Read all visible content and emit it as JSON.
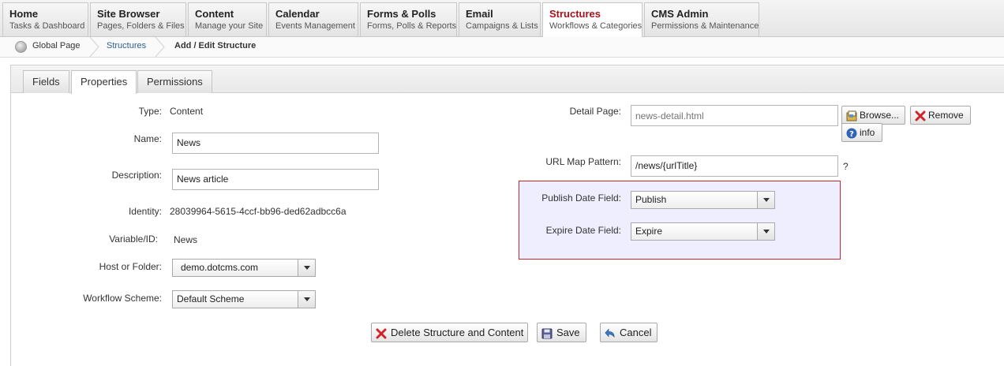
{
  "nav": {
    "tabs": [
      {
        "title": "Home",
        "subtitle": "Tasks & Dashboard"
      },
      {
        "title": "Site Browser",
        "subtitle": "Pages, Folders & Files"
      },
      {
        "title": "Content",
        "subtitle": "Manage your Site"
      },
      {
        "title": "Calendar",
        "subtitle": "Events Management"
      },
      {
        "title": "Forms & Polls",
        "subtitle": "Forms, Polls & Reports"
      },
      {
        "title": "Email",
        "subtitle": "Campaigns & Lists"
      },
      {
        "title": "Structures",
        "subtitle": "Workflows & Categories"
      },
      {
        "title": "CMS Admin",
        "subtitle": "Permissions & Maintenance"
      }
    ],
    "active": "Structures"
  },
  "breadcrumb": {
    "home": "Global Page",
    "link": "Structures",
    "current": "Add / Edit Structure"
  },
  "subtabs": [
    "Fields",
    "Properties",
    "Permissions"
  ],
  "form": {
    "type_label": "Type:",
    "type_value": "Content",
    "name_label": "Name:",
    "name_value": "News",
    "description_label": "Description:",
    "description_value": "News article",
    "identity_label": "Identity:",
    "identity_value": "28039964-5615-4ccf-bb96-ded62adbcc6a",
    "variable_label": "Variable/ID:",
    "variable_value": "News",
    "host_label": "Host or Folder:",
    "host_value": "demo.dotcms.com",
    "workflow_label": "Workflow Scheme:",
    "workflow_value": "Default Scheme",
    "detail_label": "Detail Page:",
    "detail_placeholder": "news-detail.html",
    "browse_label": "Browse...",
    "remove_label": "Remove",
    "info_label": "info",
    "urlmap_label": "URL Map Pattern:",
    "urlmap_value": "/news/{urlTitle}",
    "urlmap_help": "?",
    "publish_label": "Publish Date Field:",
    "publish_value": "Publish",
    "expire_label": "Expire Date Field:",
    "expire_value": "Expire"
  },
  "actions": {
    "delete_label": "Delete Structure and Content",
    "save_label": "Save",
    "cancel_label": "Cancel"
  },
  "colors": {
    "active_nav": "#a5131b",
    "highlight_border": "#c8252d",
    "highlight_fill": "#eeeefe",
    "link": "#2c5d8f"
  }
}
